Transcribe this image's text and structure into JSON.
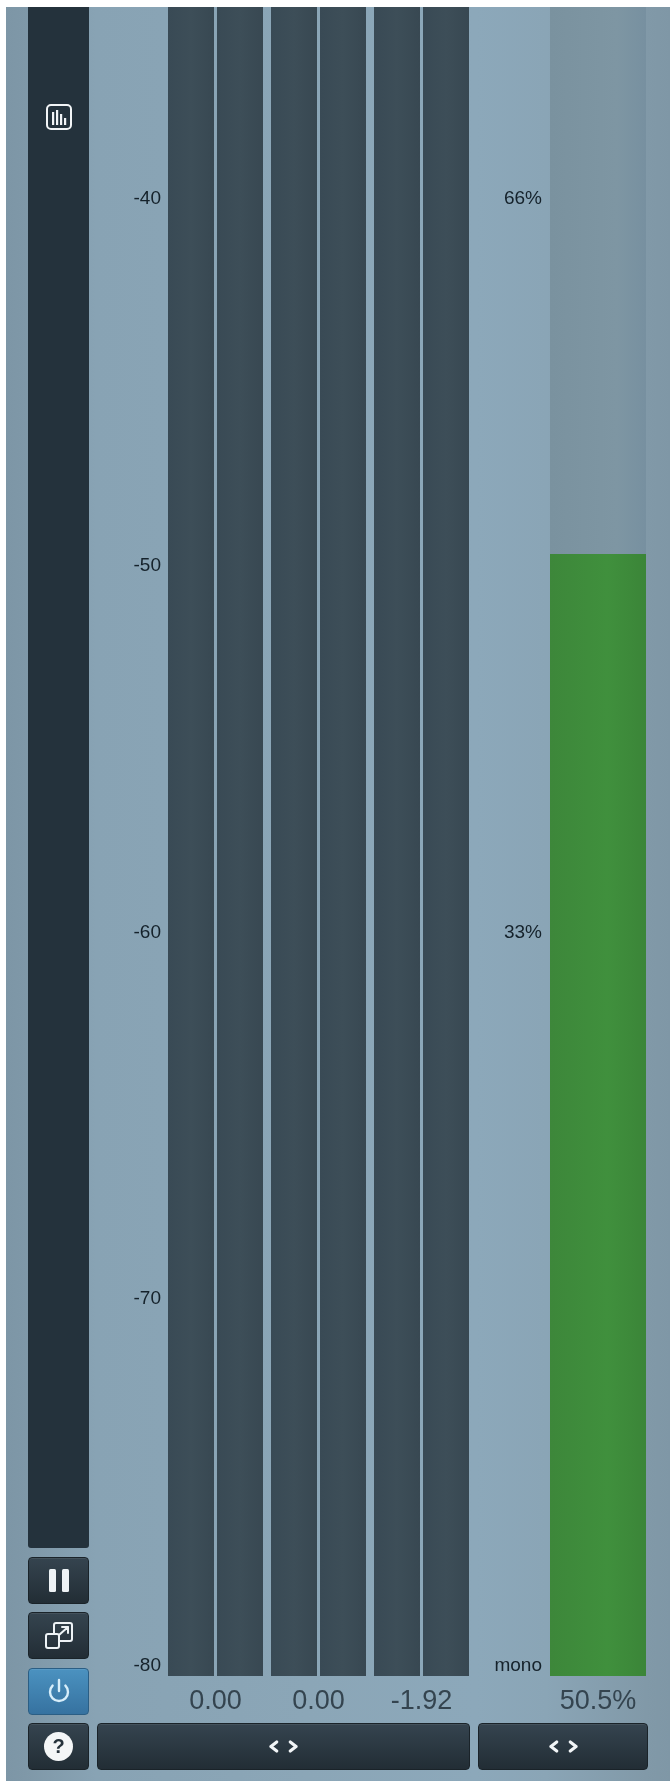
{
  "tool_buttons": [
    {
      "kind": "pause",
      "on": false
    },
    {
      "kind": "resize",
      "on": false
    },
    {
      "kind": "power",
      "on": true
    },
    {
      "kind": "help",
      "on": false,
      "label": "?"
    }
  ],
  "level_scale": {
    "ticks": [
      "-40",
      "-50",
      "-60",
      "-70",
      "-80"
    ]
  },
  "meters": [
    {
      "reading": "0.00"
    },
    {
      "reading": "0.00"
    },
    {
      "reading": "-1.92"
    }
  ],
  "width_meter": {
    "ticks": [
      "66%",
      "33%",
      "mono"
    ],
    "level": 0.672,
    "reading": "50.5%"
  }
}
